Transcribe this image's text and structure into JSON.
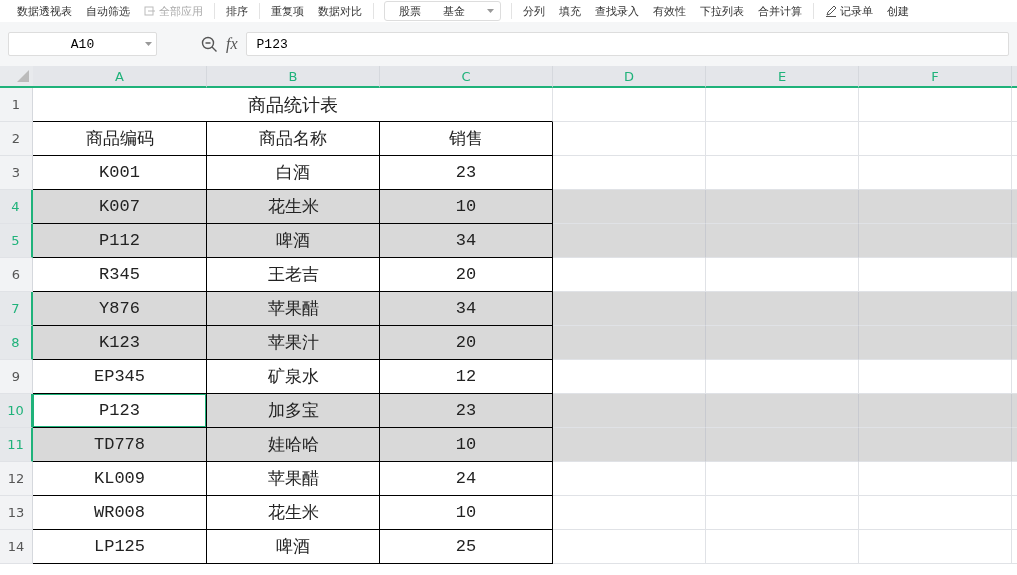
{
  "toolbar": {
    "items": [
      {
        "label": "数据透视表"
      },
      {
        "label": "自动筛选"
      },
      {
        "label": "全部应用",
        "disabled": true
      },
      {
        "label": "排序"
      },
      {
        "label": "重复项"
      },
      {
        "label": "数据对比"
      },
      {
        "label": "股票",
        "kind": "dropdown-left"
      },
      {
        "label": "基金",
        "kind": "dropdown-right"
      },
      {
        "label": "分列"
      },
      {
        "label": "填充"
      },
      {
        "label": "查找录入"
      },
      {
        "label": "有效性"
      },
      {
        "label": "下拉列表"
      },
      {
        "label": "合并计算"
      },
      {
        "label": "记录单",
        "kind": "icon"
      },
      {
        "label": "创建"
      }
    ]
  },
  "name_box": {
    "value": "A10"
  },
  "formula_bar": {
    "fx": "fx",
    "value": "P123"
  },
  "columns": [
    {
      "label": "A",
      "selected": true
    },
    {
      "label": "B",
      "selected": true
    },
    {
      "label": "C",
      "selected": true
    },
    {
      "label": "D",
      "selected": true
    },
    {
      "label": "E",
      "selected": true
    },
    {
      "label": "F",
      "selected": true
    }
  ],
  "title": {
    "row": "1",
    "text": "商品统计表"
  },
  "header": {
    "row": "2",
    "cells": [
      "商品编码",
      "商品名称",
      "销售"
    ]
  },
  "rows": [
    {
      "row": "3",
      "selected": false,
      "cells": [
        "K001",
        "白酒",
        "23"
      ]
    },
    {
      "row": "4",
      "selected": true,
      "cells": [
        "K007",
        "花生米",
        "10"
      ]
    },
    {
      "row": "5",
      "selected": true,
      "cells": [
        "P112",
        "啤酒",
        "34"
      ]
    },
    {
      "row": "6",
      "selected": false,
      "cells": [
        "R345",
        "王老吉",
        "20"
      ]
    },
    {
      "row": "7",
      "selected": true,
      "cells": [
        "Y876",
        "苹果醋",
        "34"
      ]
    },
    {
      "row": "8",
      "selected": true,
      "cells": [
        "K123",
        "苹果汁",
        "20"
      ]
    },
    {
      "row": "9",
      "selected": false,
      "cells": [
        "EP345",
        "矿泉水",
        "12"
      ]
    },
    {
      "row": "10",
      "selected": true,
      "active": true,
      "cells": [
        "P123",
        "加多宝",
        "23"
      ]
    },
    {
      "row": "11",
      "selected": true,
      "cells": [
        "TD778",
        "娃哈哈",
        "10"
      ]
    },
    {
      "row": "12",
      "selected": false,
      "cells": [
        "KL009",
        "苹果醋",
        "24"
      ]
    },
    {
      "row": "13",
      "selected": false,
      "cells": [
        "WR008",
        "花生米",
        "10"
      ]
    },
    {
      "row": "14",
      "selected": false,
      "cells": [
        "LP125",
        "啤酒",
        "25"
      ]
    }
  ]
}
